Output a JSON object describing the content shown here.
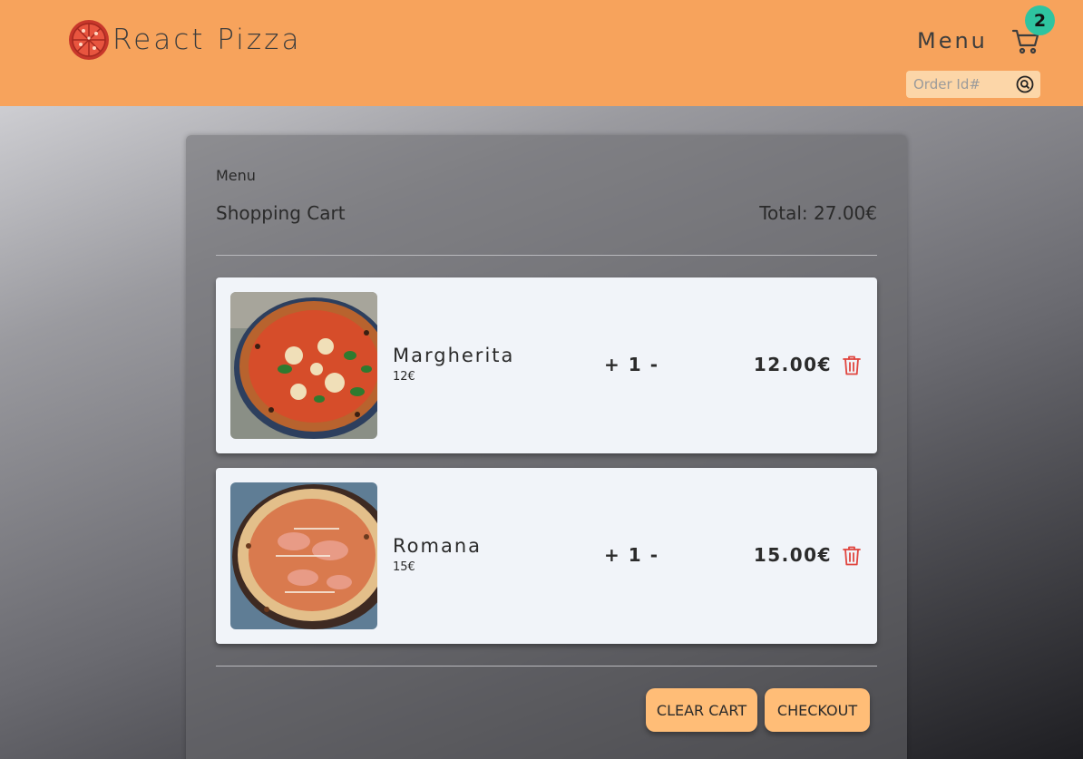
{
  "header": {
    "brand_title": "React Pizza",
    "menu_label": "Menu",
    "cart_count": "2",
    "search_placeholder": "Order Id#"
  },
  "cart": {
    "breadcrumb": "Menu",
    "title": "Shopping Cart",
    "total": "Total: 27.00€",
    "items": [
      {
        "name": "Margherita",
        "unit_price": "12€",
        "plus": "+",
        "quantity": "1",
        "minus": "-",
        "line_total": "12.00€"
      },
      {
        "name": "Romana",
        "unit_price": "15€",
        "plus": "+",
        "quantity": "1",
        "minus": "-",
        "line_total": "15.00€"
      }
    ],
    "clear_label": "CLEAR CART",
    "checkout_label": "CHECKOUT"
  },
  "colors": {
    "header_bg": "#f7a35c",
    "badge": "#2ec4a0",
    "button": "#ffbd77",
    "trash": "#e0453f"
  },
  "icons": [
    "pizza-logo-icon",
    "cart-icon",
    "search-icon",
    "trash-icon"
  ]
}
